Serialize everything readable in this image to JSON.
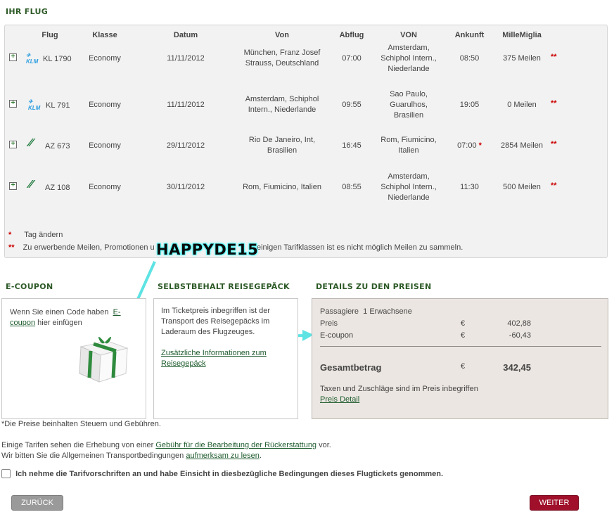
{
  "titles": {
    "flight": "IHR FLUG",
    "ecoupon": "E-COUPON",
    "baggage": "SELBSTBEHALT REISEGEPÄCK",
    "prices": "DETAILS ZU DEN PREISEN"
  },
  "table": {
    "headers": [
      "Flug",
      "Klasse",
      "Datum",
      "Von",
      "Abflug",
      "VON",
      "Ankunft",
      "MilleMiglia"
    ],
    "rows": [
      {
        "airline": "KLM",
        "flight": "KL 1790",
        "class": "Economy",
        "date": "11/11/2012",
        "from": [
          "München, Franz Josef",
          "Strauss, Deutschland"
        ],
        "dep": "07:00",
        "to": [
          "Amsterdam,",
          "Schiphol Intern.,",
          "Niederlande"
        ],
        "arr": "08:50",
        "arr_star": "",
        "miles": "375 Meilen",
        "mark": "**"
      },
      {
        "airline": "KLM",
        "flight": "KL 791",
        "class": "Economy",
        "date": "11/11/2012",
        "from": [
          "Amsterdam, Schiphol",
          "Intern., Niederlande"
        ],
        "dep": "09:55",
        "to": [
          "Sao Paulo,",
          "Guarulhos,",
          "Brasilien"
        ],
        "arr": "19:05",
        "arr_star": "",
        "miles": "0 Meilen",
        "mark": "**"
      },
      {
        "airline": "AZ",
        "flight": "AZ 673",
        "class": "Economy",
        "date": "29/11/2012",
        "from": [
          "Rio De Janeiro, Int,",
          "Brasilien"
        ],
        "dep": "16:45",
        "to": [
          "Rom, Fiumicino,",
          "Italien"
        ],
        "arr": "07:00",
        "arr_star": "*",
        "miles": "2854 Meilen",
        "mark": "**"
      },
      {
        "airline": "AZ",
        "flight": "AZ 108",
        "class": "Economy",
        "date": "30/11/2012",
        "from": [
          "Rom, Fiumicino, Italien"
        ],
        "dep": "08:55",
        "to": [
          "Amsterdam,",
          "Schiphol Intern.,",
          "Niederlande"
        ],
        "arr": "11:30",
        "arr_star": "",
        "miles": "500 Meilen",
        "mark": "**"
      }
    ]
  },
  "legend": [
    {
      "mark": "*",
      "text": "Tag ändern"
    },
    {
      "mark": "**",
      "text": "Zu erwerbende Meilen, Promotionen und ... Bei einigen Tarifklassen ist es nicht möglich Meilen zu sammeln.",
      "text_left": "Zu erwerbende Meilen, Promotionen u",
      "text_right": "einigen Tarifklassen ist es nicht möglich Meilen zu sammeln."
    }
  ],
  "coupon_code": "HAPPYDE15",
  "ecoupon": {
    "text_pre": "Wenn Sie einen Code haben",
    "link1": "E-",
    "link2": "coupon",
    "text_post": "hier einfügen"
  },
  "baggage": {
    "text": [
      "Im Ticketpreis inbegriffen ist der",
      "Transport des Reisegepäcks im",
      "Laderaum des Flugzeuges."
    ],
    "link": [
      "Zusätzliche Informationen zum",
      "Reisegepäck"
    ]
  },
  "prices": {
    "passengers_label": "Passagiere",
    "passengers_value": "1 Erwachsene",
    "lines": [
      {
        "label": "Preis",
        "currency": "€",
        "amount": "402,88"
      },
      {
        "label": "E-coupon",
        "currency": "€",
        "amount": "-60,43"
      }
    ],
    "total_label": "Gesamtbetrag",
    "total_currency": "€",
    "total_amount": "342,45",
    "note": "Taxen und Zuschläge sind im Preis inbegriffen",
    "detail_link": "Preis Detail"
  },
  "footnotes": {
    "taxes": "*Die Preise beinhalten Steuern und Gebühren.",
    "line1_pre": "Einige Tarifen sehen die Erhebung von einer",
    "line1_link": "Gebühr für die Bearbeitung der Rückerstattung",
    "line1_post": "vor.",
    "line2_pre": "Wir bitten Sie die Allgemeinen Transportbedingungen",
    "line2_link": "aufmerksam zu lesen",
    "line2_post": "."
  },
  "terms_label": "Ich nehme die Tarifvorschriften an und habe Einsicht in diesbezügliche Bedingungen dieses Flugtickets genommen.",
  "buttons": {
    "back": "ZURÜCK",
    "next": "WEITER"
  },
  "colors": {
    "accent_green": "#2d5a27",
    "next_button": "#a0102a",
    "arrow": "#5ee3e3"
  }
}
